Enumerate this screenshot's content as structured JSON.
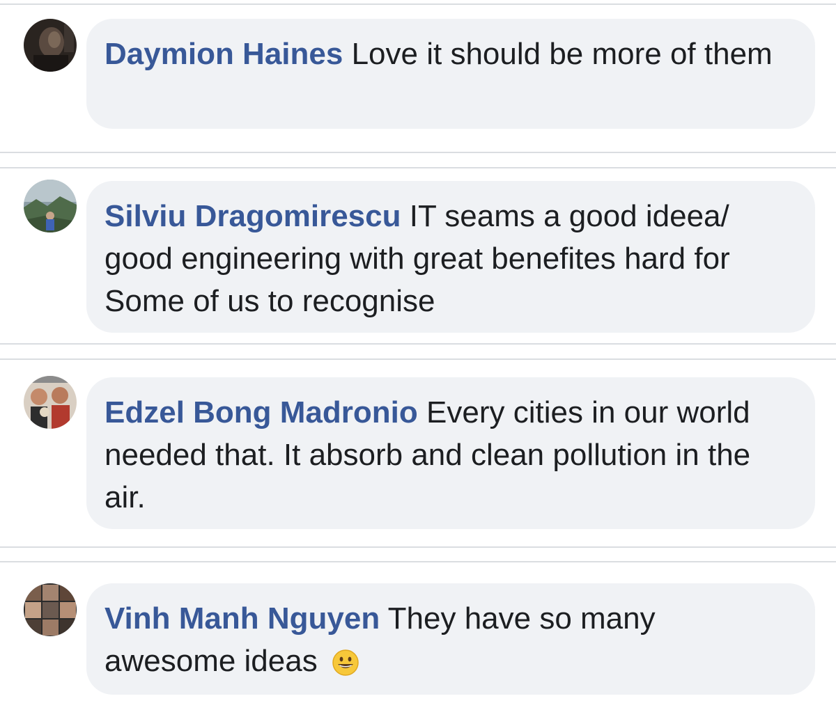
{
  "comments": [
    {
      "author": "Daymion Haines",
      "text": "Love it should be more of them",
      "avatar_icon": "profile-photo-dark-portrait"
    },
    {
      "author": "Silviu Dragomirescu",
      "text": "IT seams a good ideea/ good engineering with great benefites hard for Some of us to recognise",
      "avatar_icon": "profile-photo-outdoor-landscape"
    },
    {
      "author": "Edzel Bong Madronio",
      "text": "Every cities in our world needed that. It absorb and clean pollution in the air.",
      "avatar_icon": "profile-photo-group-selfie"
    },
    {
      "author": "Vinh Manh Nguyen",
      "text": "They have so many awesome ideas",
      "emoji": "smiling-face-emoji",
      "avatar_icon": "profile-photo-collage-grid"
    }
  ],
  "colors": {
    "name": "#385898",
    "text": "#1c1e21",
    "bubble": "#f0f2f5",
    "divider": "#dadde1"
  }
}
